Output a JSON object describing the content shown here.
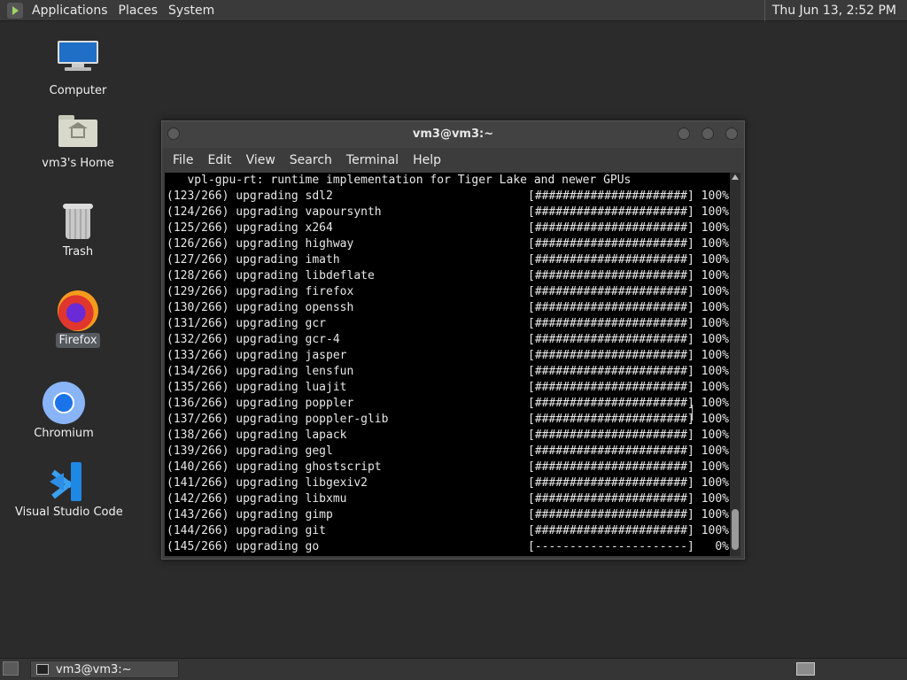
{
  "top_panel": {
    "menus": [
      "Applications",
      "Places",
      "System"
    ],
    "clock": "Thu Jun 13,  2:52 PM"
  },
  "desktop_icons": [
    {
      "label": "Computer",
      "icon": "computer-icon",
      "selected": false
    },
    {
      "label": "vm3's Home",
      "icon": "home-folder-icon",
      "selected": false
    },
    {
      "label": "Trash",
      "icon": "trash-icon",
      "selected": false
    },
    {
      "label": "Firefox",
      "icon": "firefox-icon",
      "selected": true
    },
    {
      "label": "Chromium",
      "icon": "chromium-icon",
      "selected": false
    },
    {
      "label": "Visual Studio Code",
      "icon": "vscode-icon",
      "selected": false
    }
  ],
  "terminal": {
    "title": "vm3@vm3:~",
    "menu": [
      "File",
      "Edit",
      "View",
      "Search",
      "Terminal",
      "Help"
    ],
    "lines": [
      {
        "left": "   vpl-gpu-rt: runtime implementation for Tiger Lake and newer GPUs",
        "right": ""
      },
      {
        "left": "(123/266) upgrading sdl2",
        "right": "[######################] 100%"
      },
      {
        "left": "(124/266) upgrading vapoursynth",
        "right": "[######################] 100%"
      },
      {
        "left": "(125/266) upgrading x264",
        "right": "[######################] 100%"
      },
      {
        "left": "(126/266) upgrading highway",
        "right": "[######################] 100%"
      },
      {
        "left": "(127/266) upgrading imath",
        "right": "[######################] 100%"
      },
      {
        "left": "(128/266) upgrading libdeflate",
        "right": "[######################] 100%"
      },
      {
        "left": "(129/266) upgrading firefox",
        "right": "[######################] 100%"
      },
      {
        "left": "(130/266) upgrading openssh",
        "right": "[######################] 100%"
      },
      {
        "left": "(131/266) upgrading gcr",
        "right": "[######################] 100%"
      },
      {
        "left": "(132/266) upgrading gcr-4",
        "right": "[######################] 100%"
      },
      {
        "left": "(133/266) upgrading jasper",
        "right": "[######################] 100%"
      },
      {
        "left": "(134/266) upgrading lensfun",
        "right": "[######################] 100%"
      },
      {
        "left": "(135/266) upgrading luajit",
        "right": "[######################] 100%"
      },
      {
        "left": "(136/266) upgrading poppler",
        "right": "[######################] 100%"
      },
      {
        "left": "(137/266) upgrading poppler-glib",
        "right": "[######################] 100%"
      },
      {
        "left": "(138/266) upgrading lapack",
        "right": "[######################] 100%"
      },
      {
        "left": "(139/266) upgrading gegl",
        "right": "[######################] 100%"
      },
      {
        "left": "(140/266) upgrading ghostscript",
        "right": "[######################] 100%"
      },
      {
        "left": "(141/266) upgrading libgexiv2",
        "right": "[######################] 100%"
      },
      {
        "left": "(142/266) upgrading libxmu",
        "right": "[######################] 100%"
      },
      {
        "left": "(143/266) upgrading gimp",
        "right": "[######################] 100%"
      },
      {
        "left": "(144/266) upgrading git",
        "right": "[######################] 100%"
      },
      {
        "left": "(145/266) upgrading go",
        "right": "[----------------------]   0%"
      }
    ]
  },
  "taskbar": {
    "window_button": "vm3@vm3:~"
  }
}
